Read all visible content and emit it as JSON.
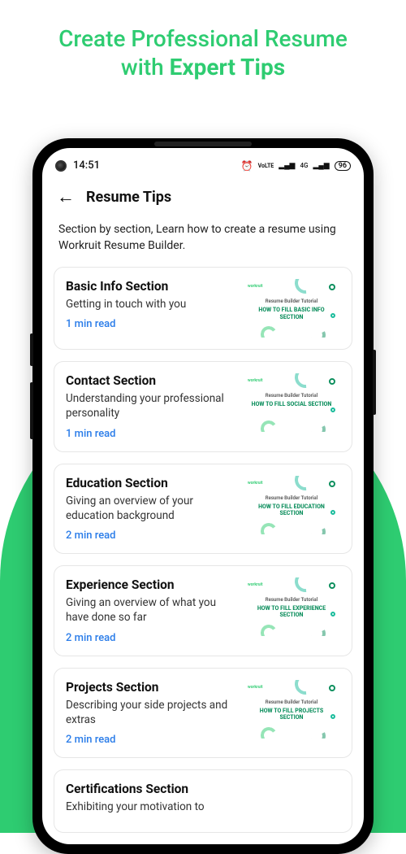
{
  "hero": {
    "line1_a": "Create Professional Resume",
    "line2_a": "with ",
    "line2_b": "Expert Tips"
  },
  "statusbar": {
    "time": "14:51",
    "alarm": "⏰",
    "volte": "VoLTE",
    "signal": "📶",
    "net": "4G",
    "battery": "96"
  },
  "header": {
    "title": "Resume Tips"
  },
  "intro": "Section by section, Learn how to create a resume using Workruit Resume Builder.",
  "thumb_brand": "workruit",
  "thumb_tutorial": "Resume Builder Tutorial",
  "items": [
    {
      "title": "Basic Info Section",
      "sub": "Getting in touch with you",
      "read": "1 min read",
      "thumb_big": "HOW TO FILL BASIC INFO SECTION"
    },
    {
      "title": "Contact Section",
      "sub": "Understanding your professional personality",
      "read": "1 min read",
      "thumb_big": "HOW TO FILL SOCIAL SECTION"
    },
    {
      "title": "Education Section",
      "sub": "Giving an overview of your education background",
      "read": "2 min read",
      "thumb_big": "HOW TO FILL EDUCATION SECTION"
    },
    {
      "title": "Experience Section",
      "sub": "Giving an overview of what you have done so far",
      "read": "2 min read",
      "thumb_big": "HOW TO FILL EXPERIENCE SECTION"
    },
    {
      "title": "Projects Section",
      "sub": "Describing your side projects and extras",
      "read": "2 min read",
      "thumb_big": "HOW TO FILL PROJECTS SECTION"
    },
    {
      "title": "Certifications Section",
      "sub": "Exhibiting your motivation to",
      "read": "",
      "thumb_big": ""
    }
  ]
}
